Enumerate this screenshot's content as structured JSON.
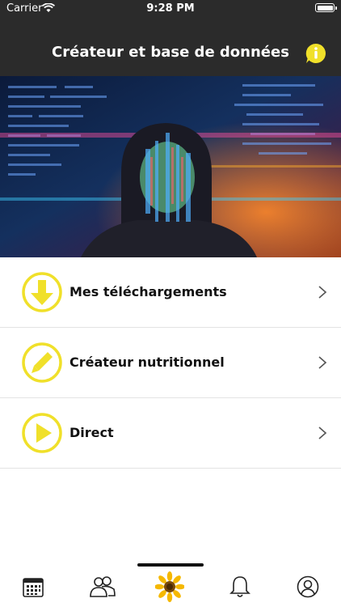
{
  "status": {
    "carrier": "Carrier",
    "time": "9:28 PM"
  },
  "header": {
    "title": "Créateur et base de données"
  },
  "menu": {
    "items": [
      {
        "label": "Mes téléchargements",
        "icon": "download-arrow-icon"
      },
      {
        "label": "Créateur nutritionnel",
        "icon": "pen-icon"
      },
      {
        "label": "Direct",
        "icon": "play-icon"
      }
    ]
  },
  "colors": {
    "accent": "#f0e02a",
    "header": "#2b2b2b",
    "text": "#111111"
  },
  "tabbar": {
    "items": [
      {
        "icon": "calendar-icon"
      },
      {
        "icon": "people-icon"
      },
      {
        "icon": "sunflower-icon"
      },
      {
        "icon": "bell-icon"
      },
      {
        "icon": "user-icon"
      }
    ]
  }
}
